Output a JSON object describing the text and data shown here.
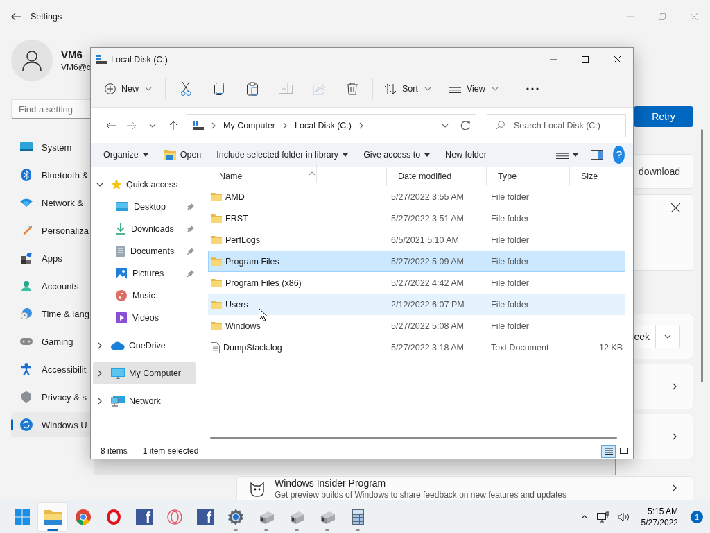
{
  "settings": {
    "title": "Settings",
    "user": {
      "name": "VM6",
      "email": "VM6@c"
    },
    "search": {
      "placeholder": "Find a setting"
    },
    "nav": [
      {
        "kind": "system",
        "label": "System",
        "selected": false
      },
      {
        "kind": "bluetooth",
        "label": "Bluetooth &",
        "selected": false
      },
      {
        "kind": "network",
        "label": "Network &",
        "selected": false
      },
      {
        "kind": "personalization",
        "label": "Personaliza",
        "selected": false
      },
      {
        "kind": "apps",
        "label": "Apps",
        "selected": false
      },
      {
        "kind": "accounts",
        "label": "Accounts",
        "selected": false
      },
      {
        "kind": "time",
        "label": "Time & lang",
        "selected": false
      },
      {
        "kind": "gaming",
        "label": "Gaming",
        "selected": false
      },
      {
        "kind": "accessibility",
        "label": "Accessibilit",
        "selected": false
      },
      {
        "kind": "privacy",
        "label": "Privacy & s",
        "selected": false
      },
      {
        "kind": "update",
        "label": "Windows U",
        "selected": true
      }
    ],
    "retry_button": "Retry",
    "download_card": "download",
    "pause_dropdown": "eek",
    "insider": {
      "title": "Windows Insider Program",
      "description": "Get preview builds of Windows to share feedback on new features and updates"
    }
  },
  "explorer": {
    "title": "Local Disk (C:)",
    "toolbar": [
      {
        "kind": "new",
        "label": "New",
        "disabled": false
      },
      {
        "kind": "cut",
        "disabled": false
      },
      {
        "kind": "copy",
        "disabled": false
      },
      {
        "kind": "paste",
        "disabled": false
      },
      {
        "kind": "rename",
        "disabled": true
      },
      {
        "kind": "share",
        "disabled": true
      },
      {
        "kind": "delete",
        "disabled": false
      },
      {
        "kind": "sort",
        "label": "Sort",
        "disabled": false
      },
      {
        "kind": "view",
        "label": "View",
        "disabled": false
      },
      {
        "kind": "more",
        "disabled": false
      }
    ],
    "breadcrumbs": [
      "My Computer",
      "Local Disk (C:)"
    ],
    "search": {
      "placeholder": "Search Local Disk (C:)"
    },
    "commands": [
      {
        "kind": "menu",
        "label": "Organize"
      },
      {
        "kind": "open",
        "label": "Open"
      },
      {
        "kind": "menu",
        "label": "Include selected folder in library"
      },
      {
        "kind": "menu",
        "label": "Give access to"
      },
      {
        "kind": "plain",
        "label": "New folder"
      }
    ],
    "navigation": [
      {
        "kind": "star",
        "label": "Quick access",
        "expanded": true,
        "selected": false,
        "children": [
          {
            "kind": "desktop",
            "label": "Desktop",
            "pinned": true,
            "selected": false
          },
          {
            "kind": "downloads",
            "label": "Downloads",
            "pinned": true,
            "selected": false
          },
          {
            "kind": "documents",
            "label": "Documents",
            "pinned": true,
            "selected": false
          },
          {
            "kind": "pictures",
            "label": "Pictures",
            "pinned": true,
            "selected": false
          },
          {
            "kind": "music",
            "label": "Music",
            "pinned": false,
            "selected": false
          },
          {
            "kind": "videos",
            "label": "Videos",
            "pinned": false,
            "selected": false
          }
        ]
      },
      {
        "kind": "cloud",
        "label": "OneDrive",
        "expanded": false,
        "selected": false
      },
      {
        "kind": "computer",
        "label": "My Computer",
        "expanded": false,
        "selected": true
      },
      {
        "kind": "network",
        "label": "Network",
        "expanded": false,
        "selected": false
      }
    ],
    "columns": [
      "Name",
      "Date modified",
      "Type",
      "Size"
    ],
    "rows": [
      {
        "kind": "folder",
        "name": "AMD",
        "date": "5/27/2022 3:55 AM",
        "type": "File folder",
        "selected": false,
        "hovered": false
      },
      {
        "kind": "folder",
        "name": "FRST",
        "date": "5/27/2022 3:51 AM",
        "type": "File folder",
        "selected": false,
        "hovered": false
      },
      {
        "kind": "folder",
        "name": "PerfLogs",
        "date": "6/5/2021 5:10 AM",
        "type": "File folder",
        "selected": false,
        "hovered": false
      },
      {
        "kind": "folder",
        "name": "Program Files",
        "date": "5/27/2022 5:09 AM",
        "type": "File folder",
        "selected": true,
        "hovered": false
      },
      {
        "kind": "folder",
        "name": "Program Files (x86)",
        "date": "5/27/2022 4:42 AM",
        "type": "File folder",
        "selected": false,
        "hovered": false
      },
      {
        "kind": "folder",
        "name": "Users",
        "date": "2/12/2022 6:07 PM",
        "type": "File folder",
        "selected": false,
        "hovered": true
      },
      {
        "kind": "folder",
        "name": "Windows",
        "date": "5/27/2022 5:08 AM",
        "type": "File folder",
        "selected": false,
        "hovered": false
      },
      {
        "kind": "file",
        "name": "DumpStack.log",
        "date": "5/27/2022 3:18 AM",
        "type": "Text Document",
        "size": "12 KB",
        "selected": false,
        "hovered": false
      }
    ],
    "status": {
      "count": "8 items",
      "selection": "1 item selected"
    },
    "view_modes": [
      {
        "kind": "details",
        "selected": true
      },
      {
        "kind": "tiles",
        "selected": false
      }
    ]
  },
  "taskbar": {
    "apps": [
      {
        "kind": "start",
        "active": false,
        "running": false
      },
      {
        "kind": "explorer",
        "active": true,
        "running": true
      },
      {
        "kind": "chrome",
        "active": false,
        "running": false
      },
      {
        "kind": "opera",
        "active": false,
        "running": false
      },
      {
        "kind": "facebook",
        "label": "f",
        "active": false,
        "running": false
      },
      {
        "kind": "operagx",
        "active": false,
        "running": false
      },
      {
        "kind": "facebook",
        "label": "f",
        "active": false,
        "running": false
      },
      {
        "kind": "settings",
        "active": false,
        "running": true
      },
      {
        "kind": "machine",
        "active": false,
        "running": true
      },
      {
        "kind": "machine",
        "active": false,
        "running": true
      },
      {
        "kind": "machine",
        "active": false,
        "running": true
      },
      {
        "kind": "calculator",
        "active": false,
        "running": true
      }
    ],
    "clock": {
      "time": "5:15 AM",
      "date": "5/27/2022"
    },
    "notifications": "1"
  }
}
